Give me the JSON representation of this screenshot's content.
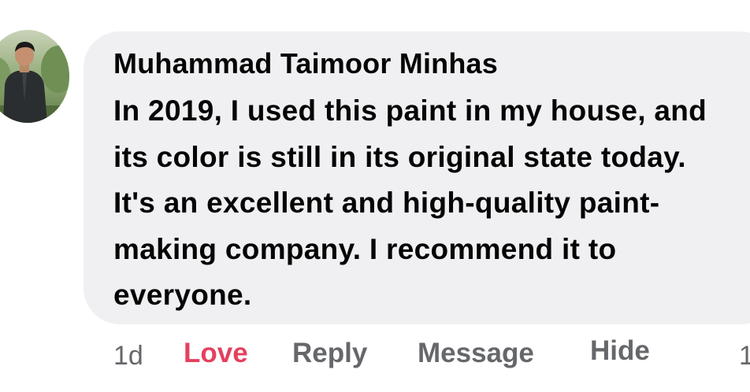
{
  "comment": {
    "author": "Muhammad Taimoor Minhas",
    "text_lines": [
      "In 2019, I used this paint in my house, and",
      "its color is still in its original state today.",
      "It's an excellent and high-quality paint-",
      "making company. I recommend it to",
      "everyone."
    ],
    "avatar_icon": "user-profile-photo"
  },
  "actions": {
    "timestamp": "1d",
    "reaction_label": "Love",
    "reply_label": "Reply",
    "message_label": "Message",
    "hide_label": "Hide",
    "reaction_count": "1"
  },
  "colors": {
    "bubble": "#f0f0f3",
    "text": "#050505",
    "muted": "#65676b",
    "love": "#e4405f"
  }
}
